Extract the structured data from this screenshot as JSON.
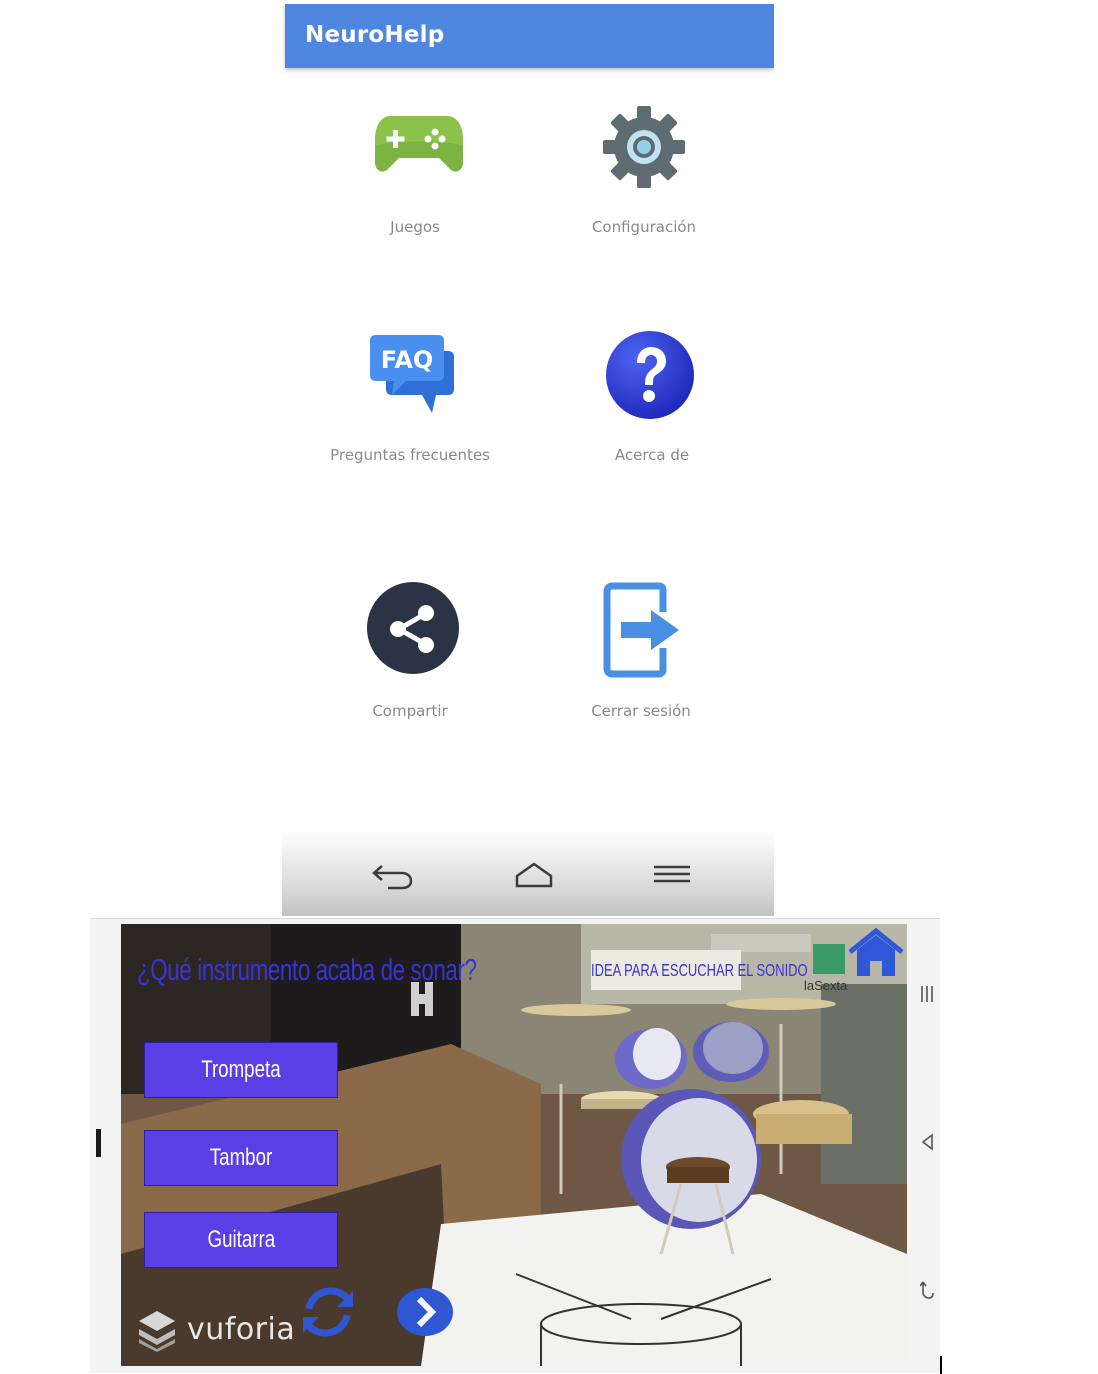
{
  "top_app": {
    "title": "NeuroHelp",
    "menu": [
      {
        "label": "Juegos",
        "icon": "gamepad-icon"
      },
      {
        "label": "Configuración",
        "icon": "gear-icon"
      },
      {
        "label": "Preguntas frecuentes",
        "icon": "faq-icon"
      },
      {
        "label": "Acerca de",
        "icon": "help-icon"
      },
      {
        "label": "Compartir",
        "icon": "share-icon"
      },
      {
        "label": "Cerrar sesión",
        "icon": "logout-icon"
      }
    ],
    "navbar": [
      "back-icon",
      "home-icon",
      "menu-icon"
    ],
    "colors": {
      "appbar": "#4f86e0",
      "gamepad": "#7cb342",
      "help": "#2f3bd1",
      "share": "#2b3446",
      "logout": "#4a90e2"
    }
  },
  "ar_game": {
    "question": "¿Qué instrumento acaba de sonar?",
    "answers": [
      "Trompeta",
      "Tambor",
      "Guitarra"
    ],
    "branding": "vuforia",
    "background_sign": "laSexta",
    "background_banner": "IDEA PARA ESCUCHAR EL SONIDO",
    "colors": {
      "answer_button": "#5a3fe6",
      "question_text": "#3a33d6",
      "home_icon": "#3057d8"
    }
  }
}
